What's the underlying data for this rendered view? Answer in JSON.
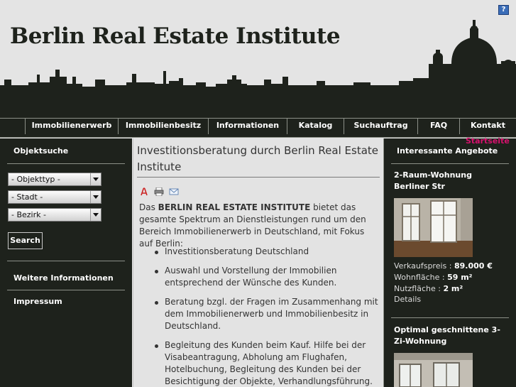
{
  "header": {
    "title": "Berlin Real Estate Institute",
    "help_label": "?"
  },
  "nav": {
    "items": [
      "Immobilienerwerb",
      "Immobilienbesitz",
      "Informationen",
      "Katalog",
      "Suchauftrag",
      "FAQ",
      "Kontakt"
    ],
    "startseite": "Startseite"
  },
  "left": {
    "heading": "Objektsuche",
    "selects": [
      "- Objekttyp -",
      "- Stadt -",
      "- Bezirk -"
    ],
    "search_label": "Search",
    "links": [
      "Weitere Informationen",
      "Impressum"
    ]
  },
  "main": {
    "title": "Investitionsberatung durch Berlin Real Estate Institute",
    "icons": [
      "pdf-icon",
      "print-icon",
      "email-icon"
    ],
    "intro_prefix": "Das ",
    "intro_bold": "BERLIN REAL ESTATE INSTITUTE",
    "intro_suffix": " bietet das gesamte Spektrum an Dienstleistungen rund um den Bereich Immobilienerwerb in Deutschland, mit Fokus auf Berlin:",
    "list": [
      "Investitionsberatung Deutschland",
      "Auswahl und Vorstellung der Immobilien entsprechend der Wünsche des Kunden.",
      "Beratung bzgl. der Fragen im Zusammenhang mit dem Immobilienerwerb und Immobilienbesitz in Deutschland.",
      "Begleitung des Kunden beim Kauf. Hilfe bei der Visabeantragung, Abholung am Flughafen, Hotelbuchung, Begleitung des Kunden bei der Besichtigung der Objekte, Verhandlungsführung."
    ]
  },
  "right": {
    "heading": "Interessante Angebote",
    "offers": [
      {
        "title": "2-Raum-Wohnung Berliner Str",
        "price_label": "Verkaufspreis : ",
        "price": "89.000 €",
        "area_label": "Wohnfläche : ",
        "area": "59 m²",
        "usable_label": "Nutzfläche : ",
        "usable": "2 m²",
        "details": "Details"
      },
      {
        "title": "Optimal geschnittene 3-Zi-Wohnung"
      }
    ]
  },
  "colors": {
    "dark": "#1e221c",
    "accent": "#d6116d",
    "header_bg": "#e4e4e4",
    "content_bg": "#e3e3e3"
  }
}
